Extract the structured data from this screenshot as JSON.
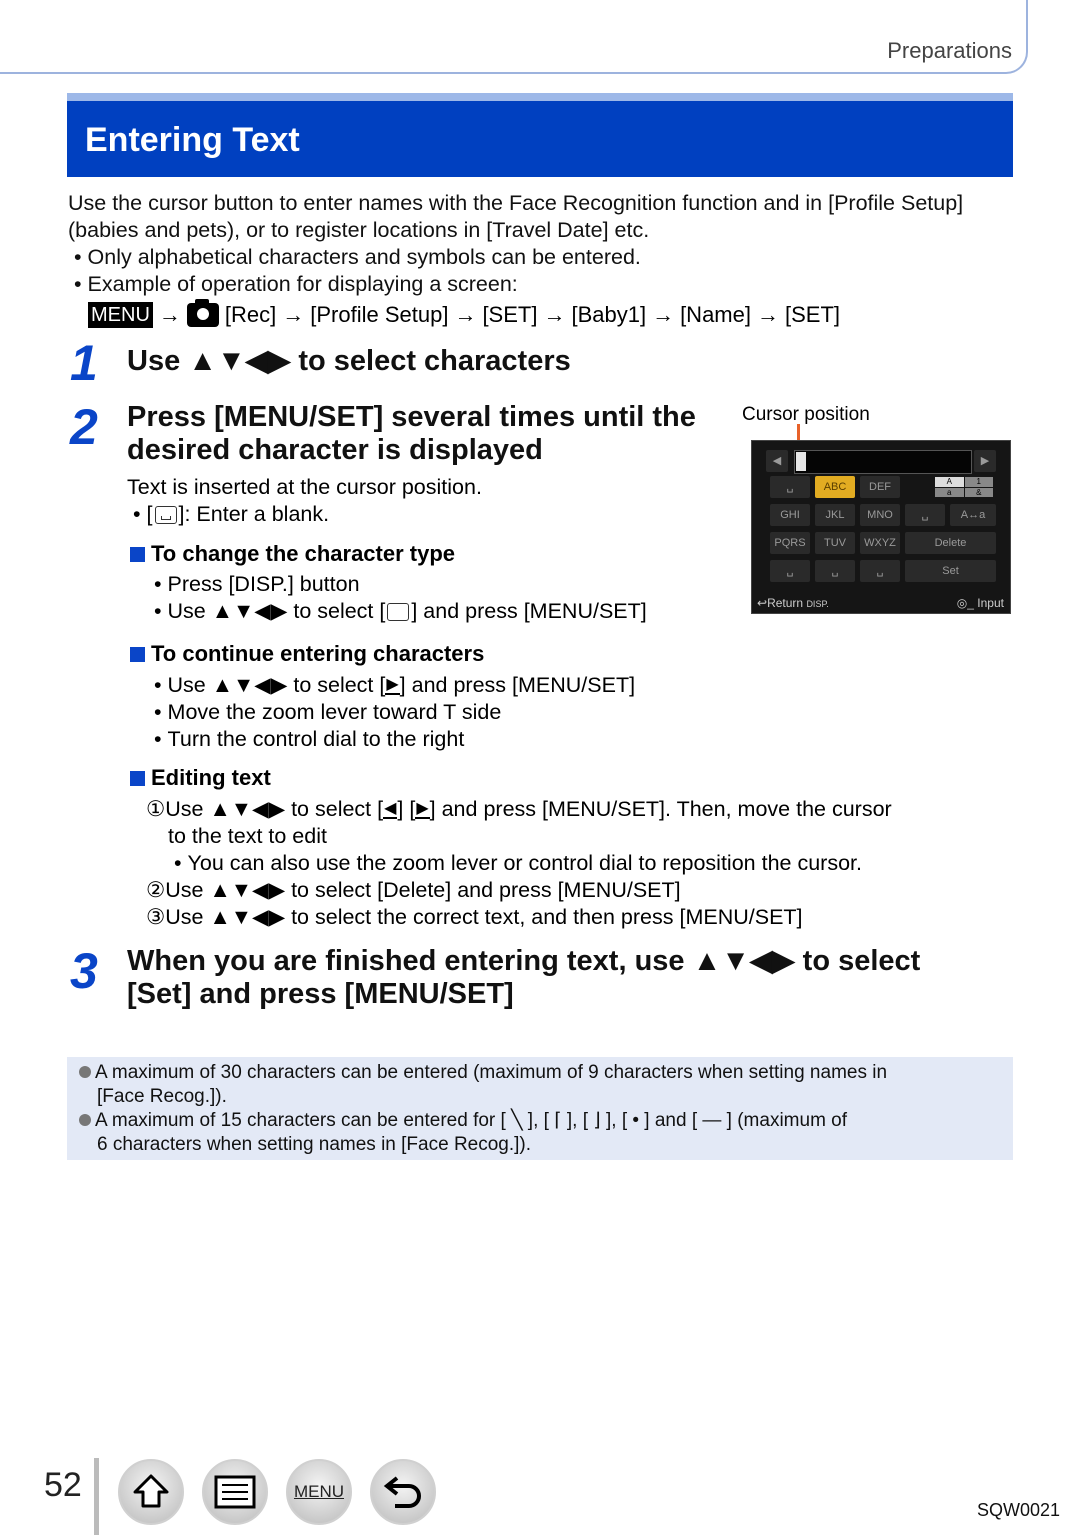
{
  "header": {
    "section": "Preparations"
  },
  "title": "Entering Text",
  "intro": {
    "paragraph": "Use the cursor button to enter names with the Face Recognition function and in [Profile Setup] (babies and pets), or to register locations in [Travel Date] etc.",
    "bullets": [
      "Only alphabetical characters and symbols can be entered.",
      "Example of operation for displaying a screen:"
    ]
  },
  "menu_path": {
    "menu_label": "MENU",
    "arrow": "→",
    "steps": [
      "[Rec]",
      "[Profile Setup]",
      "[SET]",
      "[Baby1]",
      "[Name]",
      "[SET]"
    ]
  },
  "steps": [
    {
      "num": "1",
      "heading": "Use ▲▼◀▶ to select characters"
    },
    {
      "num": "2",
      "heading_line1": "Press [MENU/SET] several times until the",
      "heading_line2": "desired character is displayed",
      "text": "Text is inserted at the cursor position.",
      "blank_note": "]: Enter a blank."
    },
    {
      "num": "3",
      "heading_line1": "When you are finished entering text, use ▲▼◀▶ to select",
      "heading_line2": "[Set] and press [MENU/SET]"
    }
  ],
  "change_type": {
    "heading": "To change the character type",
    "items": [
      "Press [DISP.] button",
      "Use ▲▼◀▶ to select [",
      "] and press [MENU/SET]"
    ]
  },
  "continue": {
    "heading": "To continue entering characters",
    "items": [
      "Use ▲▼◀▶ to select [",
      "] and press [MENU/SET]",
      "Move the zoom lever toward T side",
      "Turn the control dial to the right"
    ]
  },
  "editing": {
    "heading": "Editing text",
    "step1_a": "①Use ▲▼◀▶ to select [",
    "step1_b": "] [",
    "step1_c": "] and press [MENU/SET]. Then, move the cursor",
    "step1_d": "to the text to edit",
    "step1_note": "You can also use the zoom lever or control dial to reposition the cursor.",
    "step2": "②Use ▲▼◀▶ to select [Delete] and press [MENU/SET]",
    "step3": "③Use ▲▼◀▶ to select the correct text, and then press [MENU/SET]"
  },
  "camera_screen": {
    "cursor_label": "Cursor position",
    "keys": [
      "␣",
      "ABC",
      "DEF",
      "GHI",
      "JKL",
      "MNO",
      "␣",
      "PQRS",
      "TUV",
      "WXYZ",
      "Delete",
      "␣",
      "␣",
      "␣",
      "Set"
    ],
    "selected_key": "ABC",
    "footer_left": "Return",
    "footer_disp": "DISP.",
    "footer_right": "Input"
  },
  "notes": [
    "A maximum of 30 characters can be entered (maximum of 9 characters when setting names in",
    "[Face Recog.]).",
    "A maximum of 15 characters can be entered for [ ╲ ], [ ⌈ ], [ ⌋ ], [ • ] and [ — ] (maximum of",
    "6 characters when setting names in [Face Recog.])."
  ],
  "footer": {
    "page_number": "52",
    "nav": [
      "home",
      "contents",
      "MENU",
      "back"
    ],
    "doc_code": "SQW0021"
  }
}
